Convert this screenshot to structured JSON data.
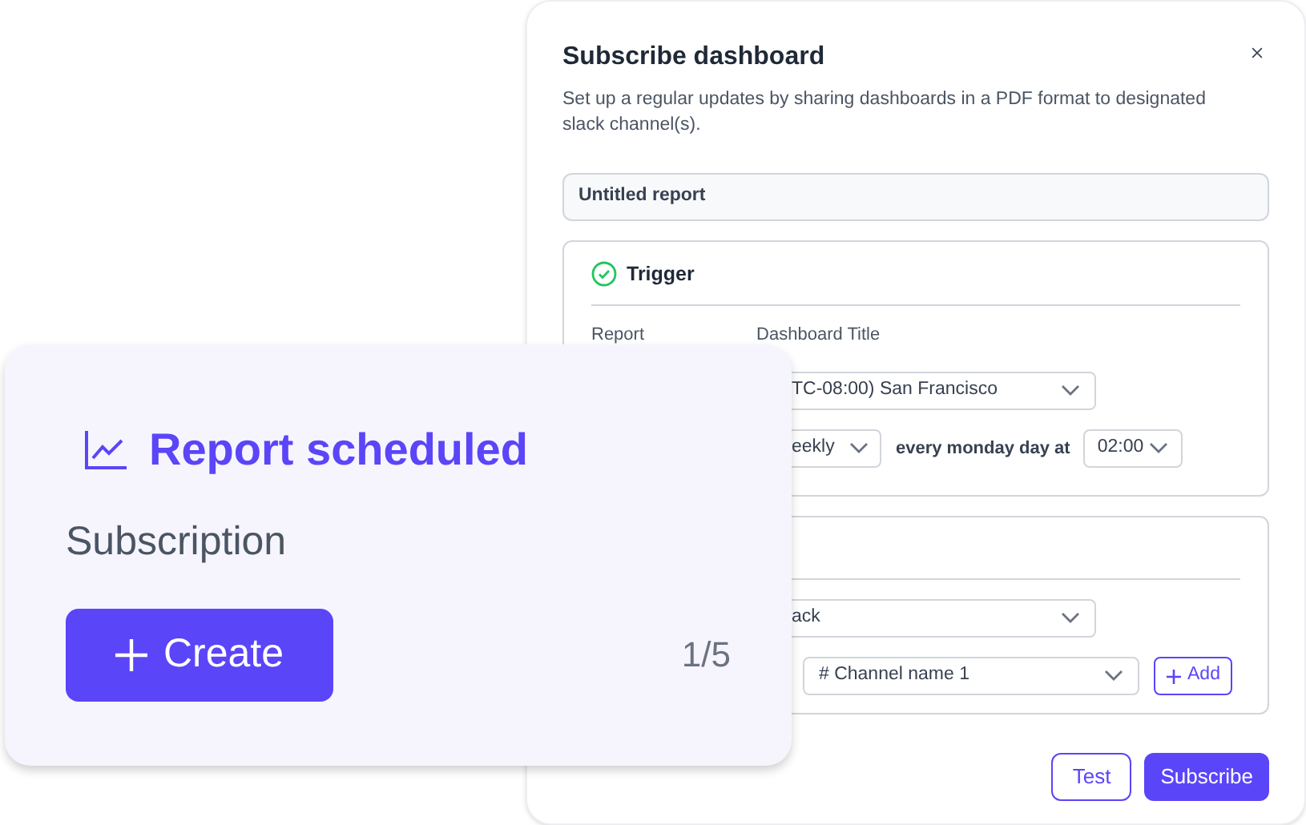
{
  "dialog": {
    "title": "Subscribe dashboard",
    "description": "Set up a regular updates by sharing dashboards in a PDF format to designated slack channel(s).",
    "report_name": {
      "value": "Untitled report"
    },
    "trigger": {
      "title": "Trigger",
      "report_label": "Report",
      "report_value": "Dashboard Title",
      "timezone": "TC-08:00) San Francisco",
      "frequency": "eekly",
      "schedule_text": "every monday day at",
      "time": "02:00"
    },
    "delivery": {
      "platform": "ack",
      "channel": "# Channel name 1",
      "add_button": "Add"
    },
    "actions": [
      {
        "label": "Test",
        "kind": "outline"
      },
      {
        "label": "Subscribe",
        "kind": "primary"
      }
    ]
  },
  "card": {
    "title": "Report scheduled",
    "subtitle": "Subscription",
    "button": "Create",
    "counter": "1/5"
  }
}
